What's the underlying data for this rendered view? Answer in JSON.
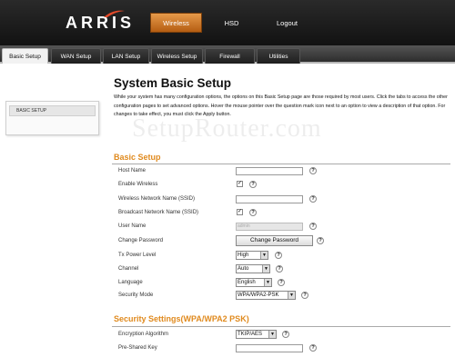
{
  "header": {
    "logo": "ARRIS",
    "tabs": [
      {
        "label": "Wireless",
        "active": true
      },
      {
        "label": "HSD",
        "active": false
      },
      {
        "label": "Logout",
        "active": false
      }
    ]
  },
  "subnav": [
    {
      "label": "Basic Setup",
      "active": true
    },
    {
      "label": "WAN Setup",
      "active": false
    },
    {
      "label": "LAN Setup",
      "active": false
    },
    {
      "label": "Wireless Setup",
      "active": false
    },
    {
      "label": "Firewall",
      "active": false
    },
    {
      "label": "Utilities",
      "active": false
    }
  ],
  "sidebar": {
    "item": "BASIC SETUP"
  },
  "main": {
    "title": "System Basic Setup",
    "intro": "While your system has many configuration options, the options on this Basic Setup page are those required by most users. Click the tabs to access the other configuration pages to set advanced options. Hover the mouse pointer over the question mark icon next to an option to view a description of that option. For changes to take effect, you must click the Apply button.",
    "watermark": "SetupRouter.com"
  },
  "basic": {
    "title": "Basic Setup",
    "host_name": {
      "label": "Host Name",
      "value": ""
    },
    "enable_wireless": {
      "label": "Enable Wireless",
      "checked": "✓"
    },
    "ssid": {
      "label": "Wireless Network Name (SSID)",
      "value": ""
    },
    "broadcast_ssid": {
      "label": "Broadcast Network Name (SSID)",
      "checked": "✓"
    },
    "user_name": {
      "label": "User Name",
      "value": "admin"
    },
    "change_password": {
      "label": "Change Password",
      "button": "Change Password"
    },
    "tx_power": {
      "label": "Tx Power Level",
      "value": "High"
    },
    "channel": {
      "label": "Channel",
      "value": "Auto"
    },
    "language": {
      "label": "Language",
      "value": "English"
    },
    "security_mode": {
      "label": "Security Mode",
      "value": "WPA/WPA2-PSK"
    }
  },
  "security": {
    "title": "Security Settings(WPA/WPA2 PSK)",
    "encryption": {
      "label": "Encryption Algorithm",
      "value": "TKIP/AES"
    },
    "psk": {
      "label": "Pre-Shared Key",
      "value": ""
    }
  },
  "help_glyph": "?",
  "arrow_glyph": "▼",
  "colors": {
    "accent_orange": "#e08a1e",
    "active_tab": "#d07a2a",
    "header_bg": "#1a1a1a"
  }
}
